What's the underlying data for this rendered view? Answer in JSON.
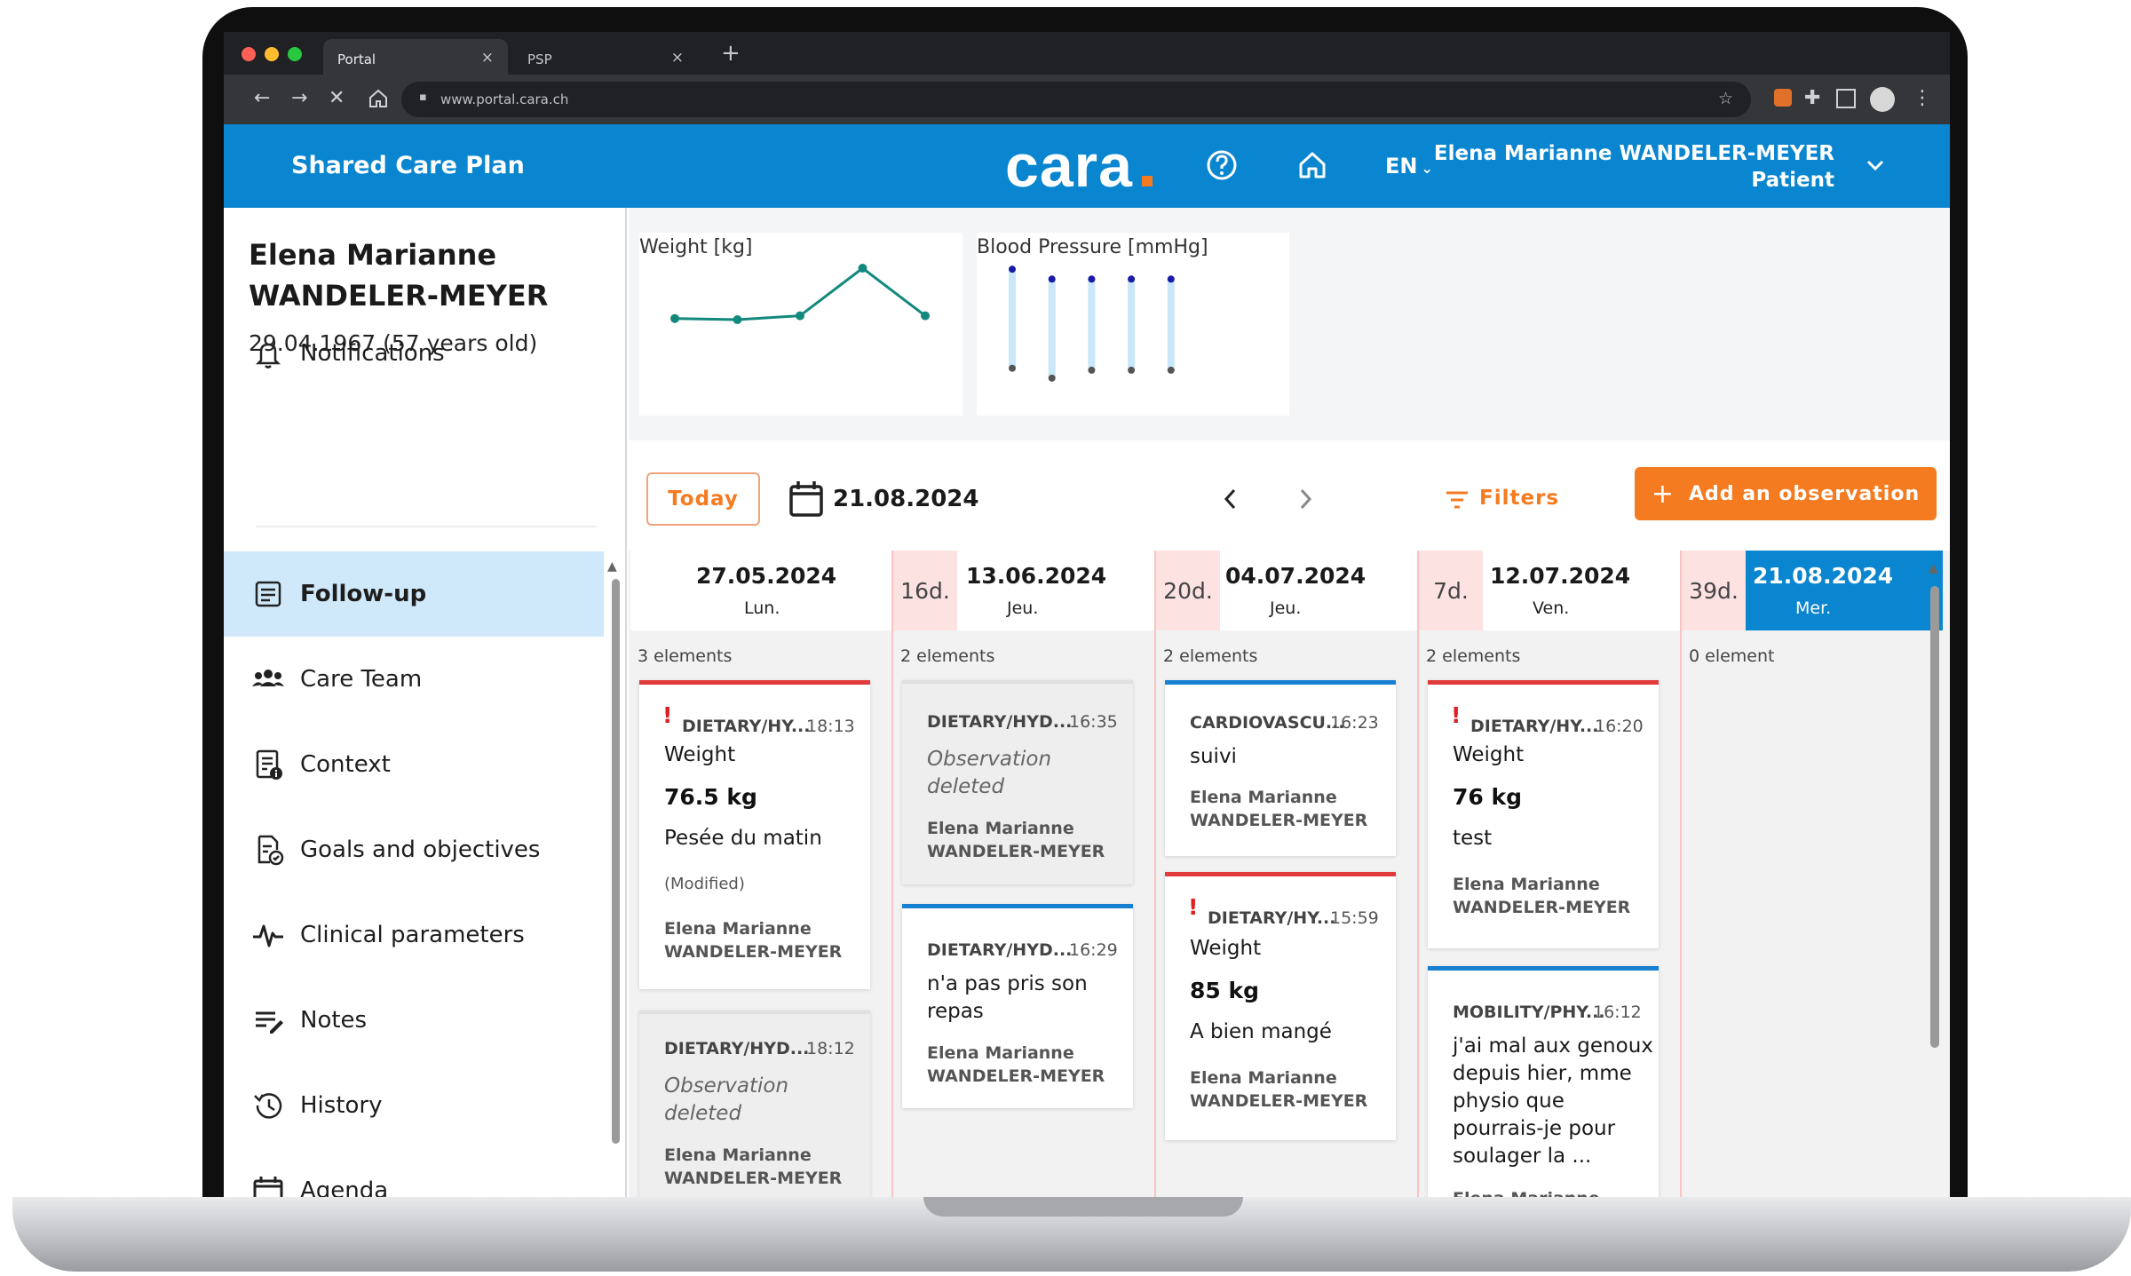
{
  "browser": {
    "tabs": [
      {
        "label": "Portal"
      },
      {
        "label": "PSP"
      }
    ],
    "url": "www.portal.cara.ch"
  },
  "header": {
    "app_title": "Shared Care Plan",
    "logo": "cara",
    "lang": "EN",
    "user_name": "Elena Marianne WANDELER-MEYER",
    "user_role": "Patient",
    "icons": [
      "help-icon",
      "home-icon",
      "chevron-down-icon"
    ],
    "color": "#0a85cf"
  },
  "patient": {
    "name_line1": "Elena Marianne",
    "name_line2": "WANDELER-MEYER",
    "dob": "29.04.1967 (57 years old)"
  },
  "nav": {
    "notifications": "Notifications",
    "items": [
      {
        "label": "Follow-up",
        "icon": "follow-up-icon",
        "active": true
      },
      {
        "label": "Care Team",
        "icon": "team-icon"
      },
      {
        "label": "Context",
        "icon": "context-icon"
      },
      {
        "label": "Goals and objectives",
        "icon": "goals-icon"
      },
      {
        "label": "Clinical parameters",
        "icon": "pulse-icon"
      },
      {
        "label": "Notes",
        "icon": "notes-icon"
      },
      {
        "label": "History",
        "icon": "history-icon"
      },
      {
        "label": "Agenda",
        "icon": "calendar-icon"
      }
    ]
  },
  "charts": {
    "weight": {
      "title": "Weight [kg]",
      "values": [
        76.0,
        75.8,
        76.5,
        85.0,
        76.5
      ],
      "color": "#13897d"
    },
    "bp": {
      "title": "Blood Pressure [mmHg]",
      "systolic": [
        140,
        135,
        135,
        135,
        135
      ],
      "diastolic": [
        90,
        85,
        89,
        89,
        89
      ]
    }
  },
  "toolbar": {
    "today": "Today",
    "date": "21.08.2024",
    "filters": "Filters",
    "add_observation": "Add an observation",
    "accent": "#f47b20"
  },
  "timeline": {
    "columns": [
      {
        "date": "27.05.2024",
        "day": "Lun.",
        "gap": "",
        "count": "3 elements",
        "cards": [
          {
            "category": "DIETARY/HY...",
            "time": "18:13",
            "urgent": true,
            "title": "Weight",
            "value": "76.5 kg",
            "note": "Pesée du matin",
            "modified": "(Modified)",
            "author1": "Elena Marianne",
            "author2": "WANDELER-MEYER"
          },
          {
            "category": "DIETARY/HYD...",
            "time": "18:12",
            "deleted": true,
            "deleted_text1": "Observation",
            "deleted_text2": "deleted",
            "author1": "Elena Marianne",
            "author2": "WANDELER-MEYER"
          }
        ]
      },
      {
        "date": "13.06.2024",
        "day": "Jeu.",
        "gap": "16d.",
        "count": "2 elements",
        "cards": [
          {
            "category": "DIETARY/HYD...",
            "time": "16:35",
            "deleted": true,
            "deleted_text1": "Observation",
            "deleted_text2": "deleted",
            "author1": "Elena Marianne",
            "author2": "WANDELER-MEYER"
          },
          {
            "category": "DIETARY/HYD...",
            "time": "16:29",
            "text1": "n'a pas pris son",
            "text2": "repas",
            "author1": "Elena Marianne",
            "author2": "WANDELER-MEYER"
          }
        ]
      },
      {
        "date": "04.07.2024",
        "day": "Jeu.",
        "gap": "20d.",
        "count": "2 elements",
        "cards": [
          {
            "category": "CARDIOVASCU...",
            "time": "16:23",
            "text1": "suivi",
            "author1": "Elena Marianne",
            "author2": "WANDELER-MEYER"
          },
          {
            "category": "DIETARY/HY...",
            "time": "15:59",
            "urgent": true,
            "title": "Weight",
            "value": "85 kg",
            "note": "A bien mangé",
            "author1": "Elena Marianne",
            "author2": "WANDELER-MEYER"
          }
        ]
      },
      {
        "date": "12.07.2024",
        "day": "Ven.",
        "gap": "7d.",
        "count": "2 elements",
        "cards": [
          {
            "category": "DIETARY/HY...",
            "time": "16:20",
            "urgent": true,
            "title": "Weight",
            "value": "76 kg",
            "note": "test",
            "author1": "Elena Marianne",
            "author2": "WANDELER-MEYER"
          },
          {
            "category": "MOBILITY/PHY...",
            "time": "16:12",
            "lines": [
              "j'ai mal aux genoux",
              "depuis hier, mme",
              "physio que",
              "pourrais-je pour",
              "soulager la ..."
            ],
            "author1": "Elena Marianne"
          }
        ]
      },
      {
        "date": "21.08.2024",
        "day": "Mer.",
        "gap": "39d.",
        "count": "0 element",
        "today": true,
        "cards": []
      }
    ]
  }
}
